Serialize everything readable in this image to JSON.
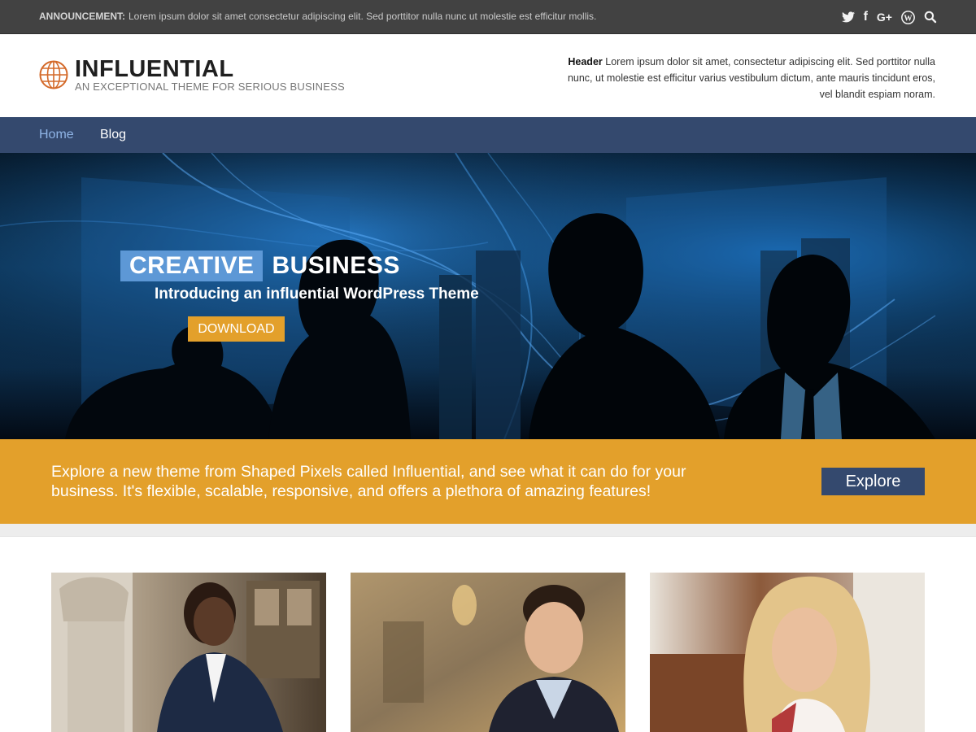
{
  "announcement": {
    "label": "ANNOUNCEMENT:",
    "text": "Lorem ipsum dolor sit amet consectetur adipiscing elit. Sed porttitor nulla nunc ut molestie est efficitur mollis."
  },
  "social_icons": [
    {
      "name": "twitter-icon",
      "glyph": "🐦"
    },
    {
      "name": "facebook-icon",
      "glyph": "f"
    },
    {
      "name": "google-plus-icon",
      "glyph": "G+"
    },
    {
      "name": "wordpress-icon",
      "glyph": "W"
    },
    {
      "name": "search-icon",
      "glyph": "⌕"
    }
  ],
  "site": {
    "title": "INFLUENTIAL",
    "tagline": "AN EXCEPTIONAL THEME FOR SERIOUS BUSINESS"
  },
  "header_text": {
    "label": "Header",
    "text": "Lorem ipsum dolor sit amet, consectetur adipiscing elit. Sed porttitor nulla nunc, ut molestie est efficitur varius vestibulum dictum, ante mauris tincidunt eros, vel blandit espiam noram."
  },
  "nav": {
    "home": "Home",
    "blog": "Blog"
  },
  "hero": {
    "title_highlight": "CREATIVE",
    "title_rest": "BUSINESS",
    "subtitle": "Introducing an influential WordPress Theme",
    "button": "DOWNLOAD"
  },
  "cta": {
    "text": "Explore a new theme from Shaped Pixels called Influential, and see what it can do for your business. It's flexible, scalable, responsive, and offers a plethora of amazing features!",
    "button": "Explore"
  },
  "colors": {
    "topbar": "#424242",
    "nav": "#34496e",
    "accent": "#e3a02b",
    "highlight": "#5d98d6",
    "logo": "#d46a2a"
  }
}
